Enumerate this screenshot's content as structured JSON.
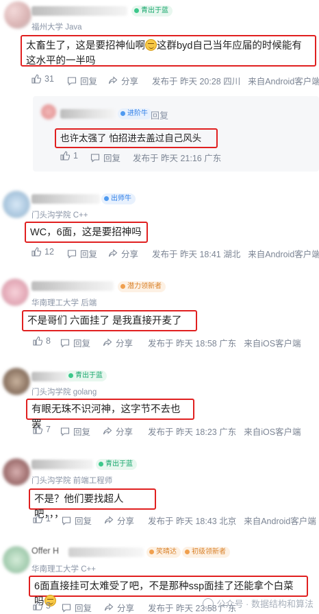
{
  "actions": {
    "reply": "回复",
    "share": "分享"
  },
  "comments": [
    {
      "badge": "青出于蓝",
      "school": "福州大学 Java",
      "text": "太畜生了，这是要招神仙啊",
      "text2": "这群byd自己当年应届的时候能有这水平的一半吗",
      "likes": "31",
      "meta": "发布于 昨天 20:28 四川",
      "source": "来自Android客户端"
    },
    {
      "badge": "进阶牛",
      "reply_label": "回复",
      "text": "也许太强了 怕招进去盖过自己风头",
      "likes": "1",
      "meta": "发布于 昨天 21:16 广东"
    },
    {
      "badge": "出师牛",
      "school": "门头沟学院 C++",
      "text": "WC，6面，这是要招神吗",
      "likes": "12",
      "meta": "发布于 昨天 18:41 湖北",
      "source": "来自Android客户端"
    },
    {
      "badge": "潜力领新者",
      "school": "华南理工大学 后端",
      "text": "不是哥们  六面挂了  是我直接开麦了",
      "likes": "8",
      "meta": "发布于 昨天 18:58 广东",
      "source": "来自iOS客户端"
    },
    {
      "badge": "青出于蓝",
      "school": "门头沟学院 golang",
      "text": "有眼无珠不识河神，这字节不去也罢",
      "likes": "7",
      "meta": "发布于 昨天 18:23 广东",
      "source": "来自iOS客户端"
    },
    {
      "badge": "青出于蓝",
      "school": "门头沟学院 前端工程师",
      "text": "不是？他们要找超人吧，，，",
      "likes": "1",
      "meta": "发布于 昨天 18:43 北京",
      "source": "来自Android客户端"
    },
    {
      "badge": "初级领新者",
      "badge2": "笑晴达",
      "name_partial": "Offer H",
      "school": "华南理工大学 C++",
      "text": "6面直接挂可太难受了吧，不是那种ssp面挂了还能拿个白菜吗",
      "likes": "5",
      "meta": "发布于 昨天 23:58 广东"
    }
  ],
  "watermark": "公众号 · 数据结构和算法"
}
